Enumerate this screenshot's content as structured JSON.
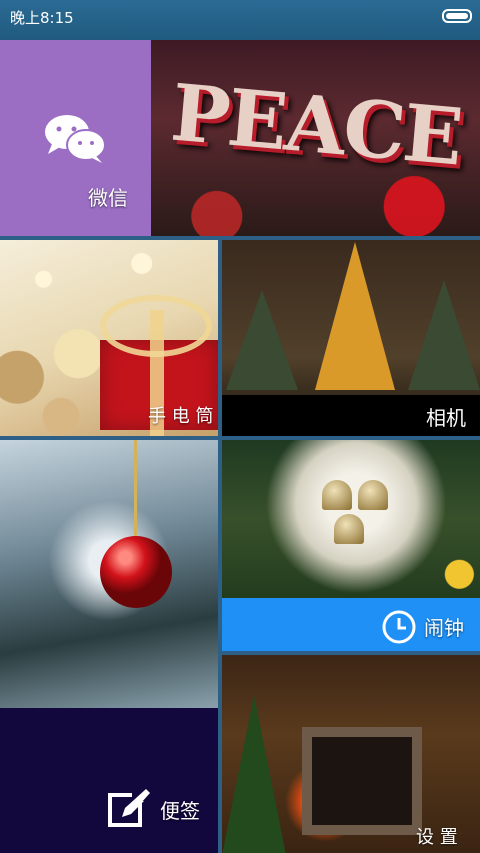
{
  "status_bar": {
    "time": "晚上8:15",
    "battery_level": 100
  },
  "tiles": {
    "wechat": {
      "label": "微信",
      "icon": "wechat-icon",
      "color": "#9b6ec4"
    },
    "peace_photo": {
      "text": "PEACE"
    },
    "flashlight": {
      "label": "手 电 筒"
    },
    "camera": {
      "label": "相机"
    },
    "notes": {
      "label": "便签",
      "icon": "edit-note-icon",
      "color": "#12083e"
    },
    "alarm": {
      "label": "闹钟",
      "icon": "clock-icon",
      "color": "#1e90f6"
    },
    "settings": {
      "label": "设 置"
    }
  }
}
